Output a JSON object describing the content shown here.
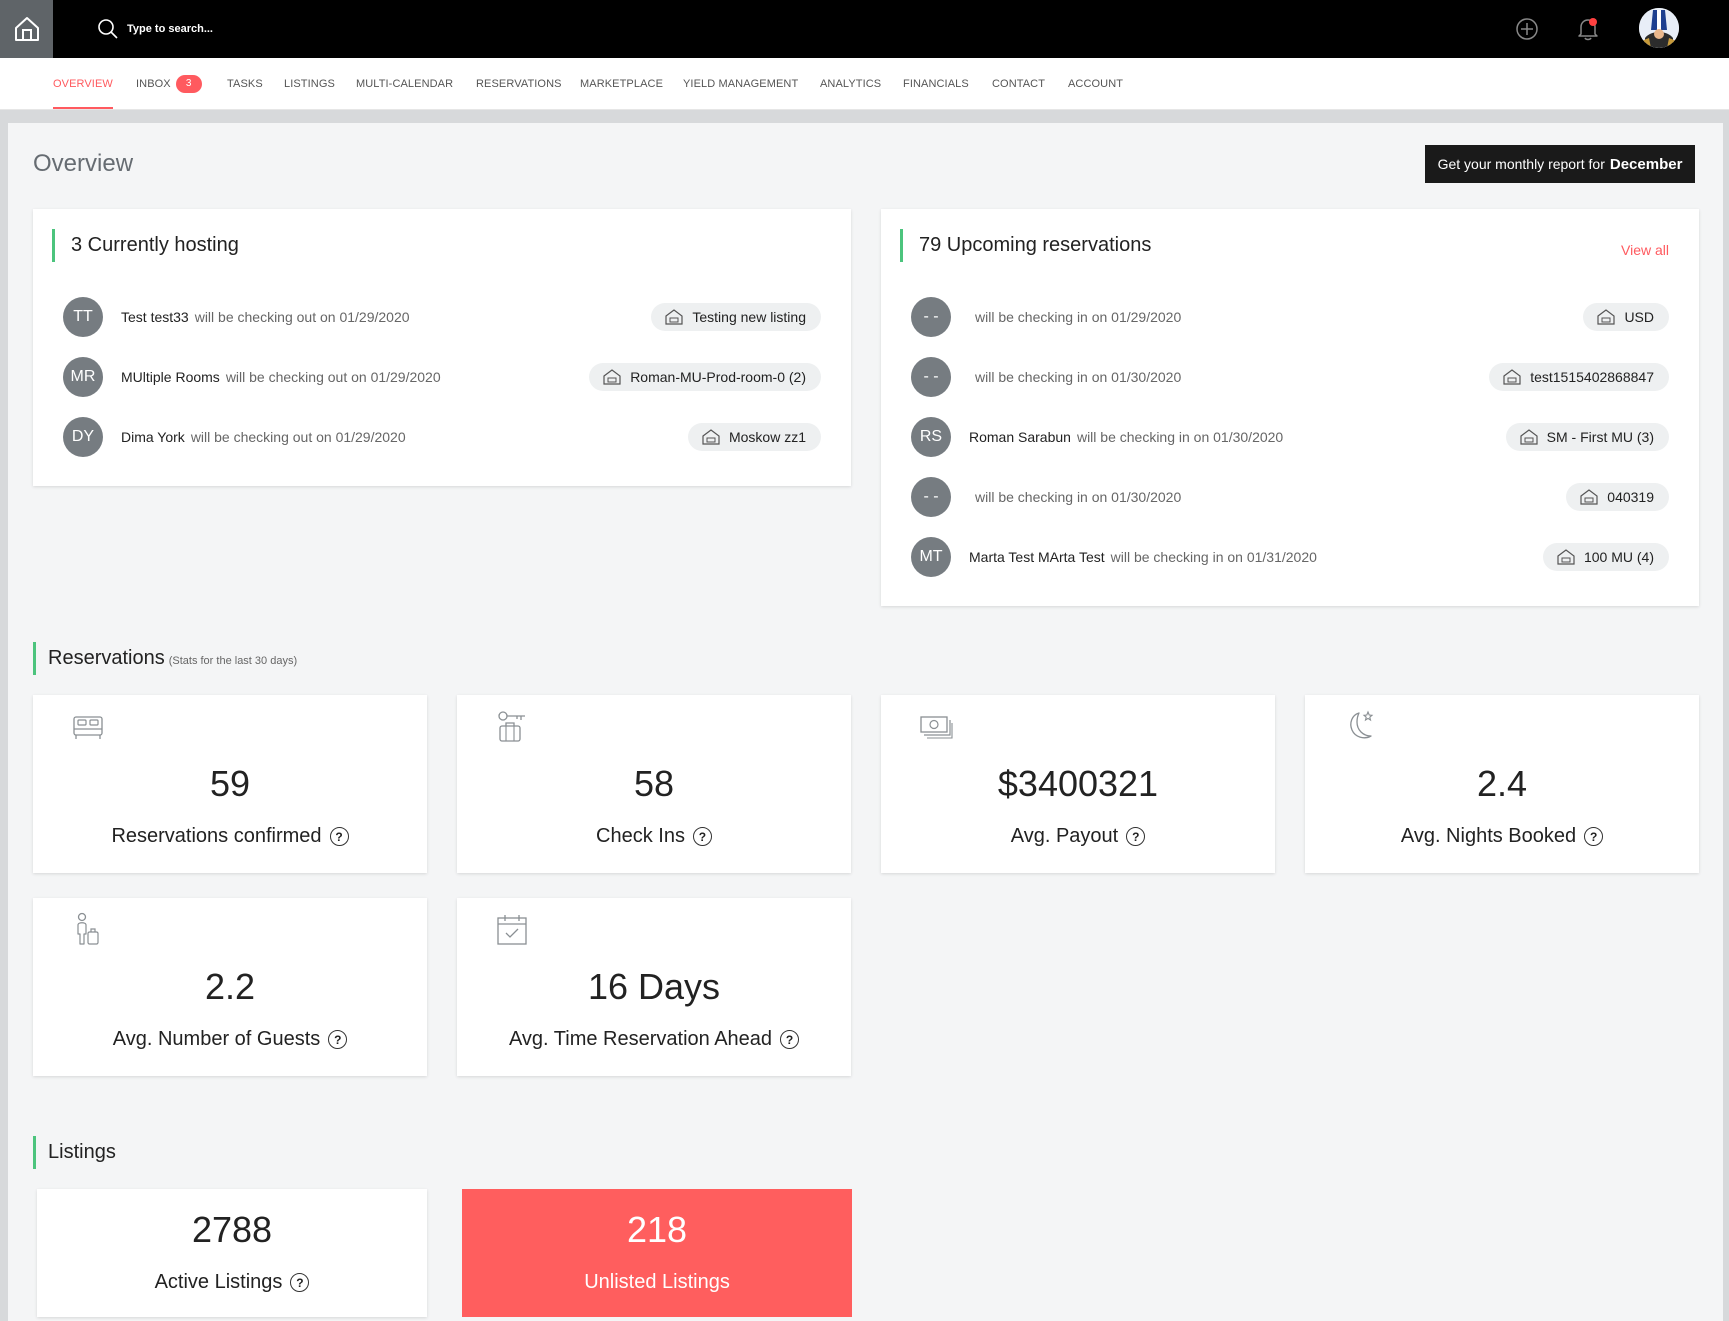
{
  "search": {
    "placeholder": "Type to search..."
  },
  "nav": {
    "items": [
      {
        "label": "OVERVIEW",
        "active": true
      },
      {
        "label": "INBOX",
        "badge": "3"
      },
      {
        "label": "TASKS"
      },
      {
        "label": "LISTINGS"
      },
      {
        "label": "MULTI-CALENDAR"
      },
      {
        "label": "RESERVATIONS"
      },
      {
        "label": "MARKETPLACE"
      },
      {
        "label": "YIELD MANAGEMENT"
      },
      {
        "label": "ANALYTICS"
      },
      {
        "label": "FINANCIALS"
      },
      {
        "label": "CONTACT"
      },
      {
        "label": "ACCOUNT"
      }
    ]
  },
  "page": {
    "title": "Overview",
    "report_label": "Get your monthly report for",
    "report_month": "December"
  },
  "hosting": {
    "title": "3 Currently hosting",
    "rows": [
      {
        "initials": "TT",
        "name": "Test test33",
        "text": "will be checking out on 01/29/2020",
        "listing": "Testing new listing"
      },
      {
        "initials": "MR",
        "name": "MUltiple Rooms",
        "text": "will be checking out on 01/29/2020",
        "listing": "Roman-MU-Prod-room-0 (2)"
      },
      {
        "initials": "DY",
        "name": "Dima York",
        "text": "will be checking out on 01/29/2020",
        "listing": "Moskow zz1"
      }
    ]
  },
  "upcoming": {
    "title": "79 Upcoming reservations",
    "view_all": "View all",
    "rows": [
      {
        "initials": "- -",
        "name": "",
        "text": "will be checking in on 01/29/2020",
        "listing": "USD"
      },
      {
        "initials": "- -",
        "name": "",
        "text": "will be checking in on 01/30/2020",
        "listing": "test1515402868847"
      },
      {
        "initials": "RS",
        "name": "Roman Sarabun",
        "text": "will be checking in on 01/30/2020",
        "listing": "SM - First MU (3)"
      },
      {
        "initials": "- -",
        "name": "",
        "text": "will be checking in on 01/30/2020",
        "listing": "040319"
      },
      {
        "initials": "MT",
        "name": "Marta Test MArta Test",
        "text": "will be checking in on 01/31/2020",
        "listing": "100 MU (4)"
      }
    ]
  },
  "reservations": {
    "title": "Reservations",
    "subtitle": "(Stats for the last 30 days)",
    "stats": [
      {
        "value": "59",
        "label": "Reservations confirmed",
        "icon": "bed-icon"
      },
      {
        "value": "58",
        "label": "Check Ins",
        "icon": "key-luggage-icon"
      },
      {
        "value": "$3400321",
        "label": "Avg. Payout",
        "icon": "cash-icon"
      },
      {
        "value": "2.4",
        "label": "Avg. Nights Booked",
        "icon": "moon-star-icon"
      },
      {
        "value": "2.2",
        "label": "Avg. Number of Guests",
        "icon": "guest-luggage-icon"
      },
      {
        "value": "16 Days",
        "label": "Avg. Time Reservation Ahead",
        "icon": "calendar-check-icon"
      }
    ]
  },
  "listings": {
    "title": "Listings",
    "active": {
      "value": "2788",
      "label": "Active Listings"
    },
    "unlisted": {
      "value": "218",
      "label": "Unlisted Listings"
    }
  },
  "help_glyph": "?",
  "colors": {
    "accent": "#ff5a5f",
    "green": "#4cc47d",
    "unlisted_bg": "#ff5e5e"
  }
}
